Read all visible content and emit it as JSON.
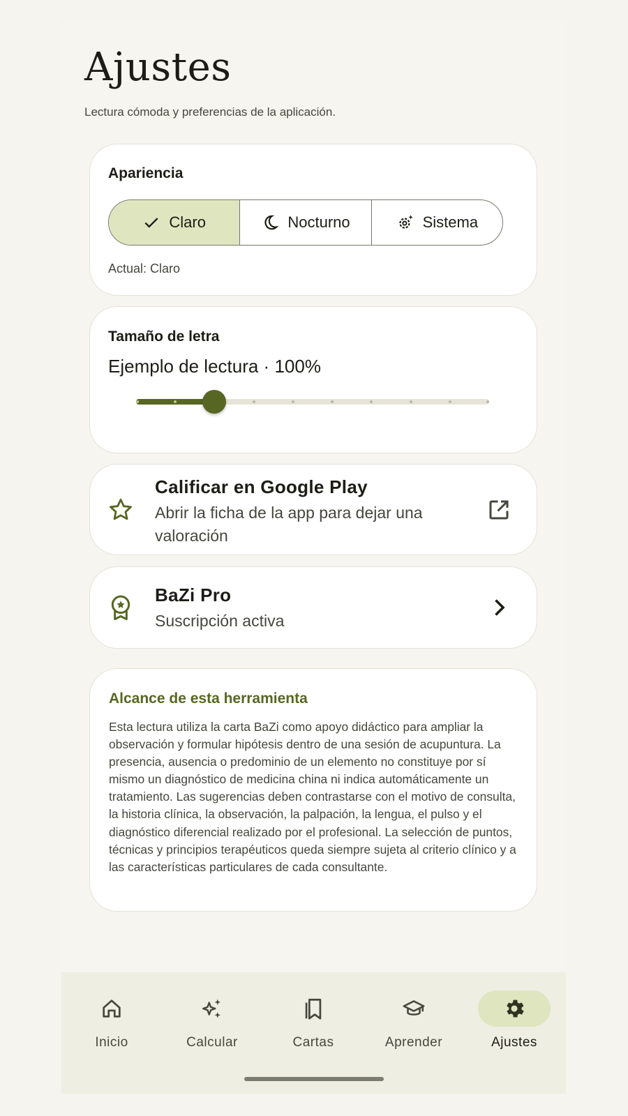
{
  "header": {
    "title": "Ajustes",
    "subtitle": "Lectura cómoda y preferencias de la aplicación."
  },
  "appearance": {
    "title": "Apariencia",
    "options": [
      {
        "label": "Claro",
        "icon": "check-icon",
        "selected": true
      },
      {
        "label": "Nocturno",
        "icon": "moon-icon",
        "selected": false
      },
      {
        "label": "Sistema",
        "icon": "auto-settings-icon",
        "selected": false
      }
    ],
    "current": "Actual: Claro"
  },
  "font_size": {
    "title": "Tamaño de letra",
    "sample": "Ejemplo de lectura · 100%",
    "slider": {
      "steps": 10,
      "value_step": 2,
      "value_percent": 100
    }
  },
  "rate": {
    "title": "Calificar en Google Play",
    "subtitle": "Abrir la ficha de la app para dejar una valoración",
    "icon": "star-outline-icon",
    "trailing_icon": "open-in-new-icon"
  },
  "pro": {
    "title": "BaZi Pro",
    "subtitle": "Suscripción activa",
    "icon": "award-badge-icon",
    "trailing_icon": "chevron-right-icon"
  },
  "scope": {
    "title": "Alcance de esta herramienta",
    "body": "Esta lectura utiliza la carta BaZi como apoyo didáctico para ampliar la observación y formular hipótesis dentro de una sesión de acupuntura. La presencia, ausencia o predominio de un elemento no constituye por sí mismo un diagnóstico de medicina china ni indica automáticamente un tratamiento. Las sugerencias deben contrastarse con el motivo de consulta, la historia clínica, la observación, la palpación, la lengua, el pulso y el diagnóstico diferencial realizado por el profesional. La selección de puntos, técnicas y principios terapéuticos queda siempre sujeta al criterio clínico y a las características particulares de cada consultante."
  },
  "nav": {
    "items": [
      {
        "label": "Inicio",
        "icon": "home-icon",
        "active": false
      },
      {
        "label": "Calcular",
        "icon": "sparkles-icon",
        "active": false
      },
      {
        "label": "Cartas",
        "icon": "bookmarks-icon",
        "active": false
      },
      {
        "label": "Aprender",
        "icon": "graduation-cap-icon",
        "active": false
      },
      {
        "label": "Ajustes",
        "icon": "gear-icon",
        "active": true
      }
    ]
  },
  "colors": {
    "accent": "#586624",
    "accent_container": "#dfe5bf",
    "background": "#f6f5ef",
    "surface": "#ffffff",
    "nav_background": "#efeee3"
  }
}
